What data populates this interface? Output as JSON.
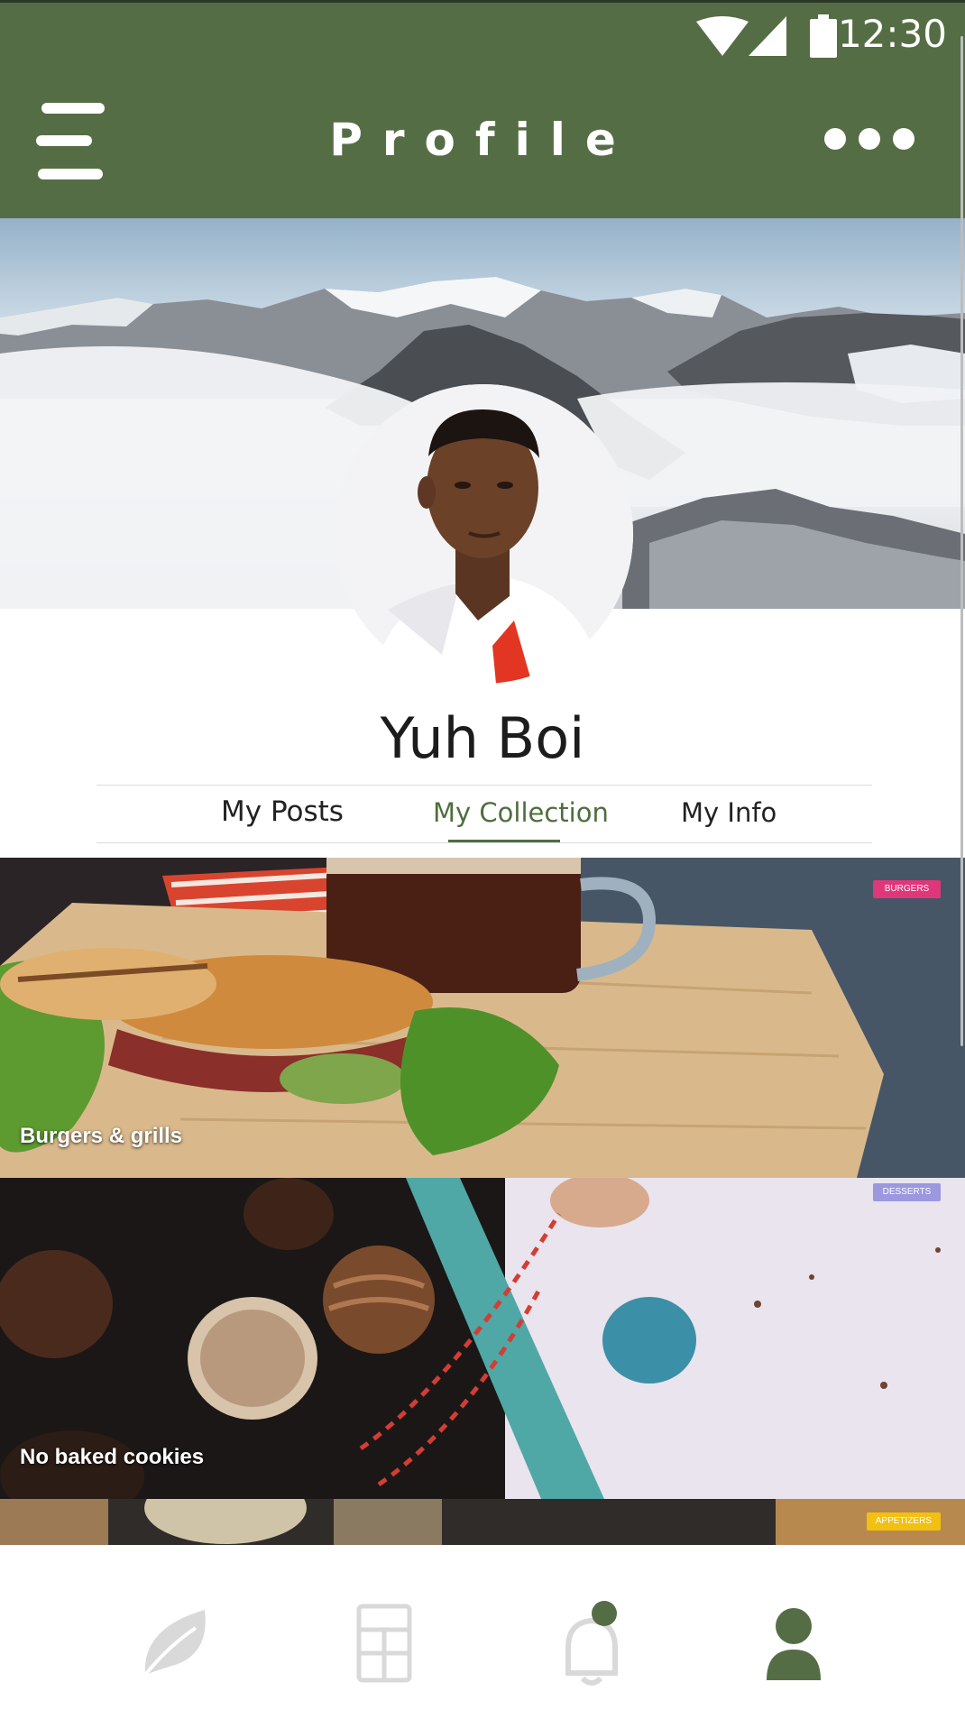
{
  "status_bar": {
    "time": "12:30",
    "icons": [
      "wifi-icon",
      "cellular-signal-icon",
      "battery-icon"
    ]
  },
  "app_bar": {
    "title": "Profile",
    "menu_icon": "hamburger-menu-icon",
    "more_icon": "more-dots-icon"
  },
  "profile": {
    "name": "Yuh Boi",
    "cover_image": "snowy-mountain-peaks-above-clouds",
    "avatar_image": "young-man-in-white-polo-portrait"
  },
  "tabs": [
    {
      "label": "My Posts"
    },
    {
      "label": "My Collection",
      "active": true
    },
    {
      "label": "My Info"
    }
  ],
  "collection": [
    {
      "title": "Burgers & grills",
      "badge": "BURGERS",
      "badge_color": "#e0377a",
      "image": "grilled-sandwich-and-coffee"
    },
    {
      "title": "No baked cookies",
      "badge": "DESSERTS",
      "badge_color": "#9b98e0",
      "image": "chocolate-truffles"
    },
    {
      "title": "",
      "badge": "APPETIZERS",
      "badge_color": "#f2c011",
      "image": "appetizer-dishes"
    }
  ],
  "bottom_nav": [
    {
      "icon": "leaf-icon",
      "active": false
    },
    {
      "icon": "recipe-book-icon",
      "active": false
    },
    {
      "icon": "notification-bell-icon",
      "active": false,
      "has_badge": true
    },
    {
      "icon": "profile-person-icon",
      "active": true
    }
  ],
  "colors": {
    "brand": "#556d45",
    "accent": "#4f6e3f",
    "nav_inactive": "#d9d9d9"
  }
}
